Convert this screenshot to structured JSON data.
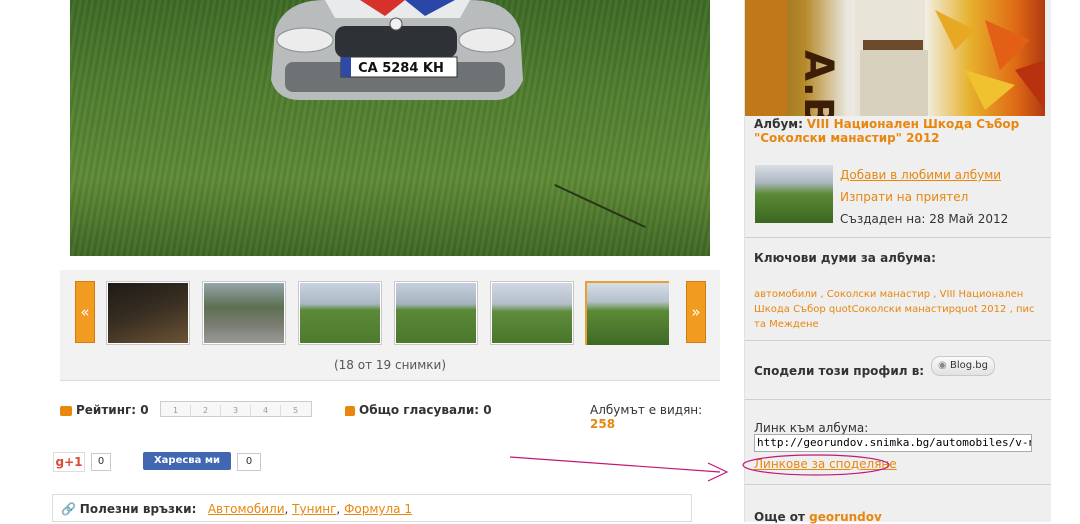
{
  "photo": {
    "plate": "CA 5284 KH"
  },
  "gallery": {
    "prev_arrow": "«",
    "next_arrow": "»",
    "counter": "(18 от 19 снимки)",
    "thumbs": [
      {
        "name": "thumb-1",
        "active": false
      },
      {
        "name": "thumb-2",
        "active": false
      },
      {
        "name": "thumb-3",
        "active": false
      },
      {
        "name": "thumb-4",
        "active": false
      },
      {
        "name": "thumb-5",
        "active": false
      },
      {
        "name": "thumb-6",
        "active": true
      }
    ]
  },
  "rating": {
    "label": "Рейтинг: 0",
    "scale": [
      "1",
      "2",
      "3",
      "4",
      "5"
    ],
    "votes_label": "Общо гласували: 0",
    "views_label": "Албумът е видян:",
    "views_value": "258"
  },
  "social": {
    "gplus_label": "g+1",
    "gplus_count": "0",
    "fb_label": "Харесва ми",
    "fb_count": "0"
  },
  "useful": {
    "label": "Полезни връзки:",
    "links": [
      "Автомобили",
      "Тунинг",
      "Формула 1"
    ],
    "separator": ","
  },
  "sidebar": {
    "album_prefix": "Албум:",
    "album_title": "VIII Национален Шкода Събор \"Соколски манастир\" 2012",
    "add_fav": "Добави в любими албуми",
    "send_friend": "Изпрати на приятел",
    "created": "Създаден на: 28 Май 2012",
    "keywords_title": "Ключови думи за албума:",
    "tags_line1": [
      "автомобили",
      "Соколски манастир",
      "VIII Национален"
    ],
    "tags_line2": "Шкода Събор quotСоколски манастирquot 2012",
    "tags_line2_tail": "пис",
    "tags_line3": "та Междене",
    "share_title": "Сподели този профил в:",
    "blog_button": "Blog.bg",
    "link_label": "Линк към албума:",
    "link_value": "http://georundov.snimka.bg/automobiles/v-nacion",
    "share_links": "Линкове за споделяне",
    "more_prefix": "Още от",
    "more_user": "georundov"
  },
  "colors": {
    "accent": "#e8860e",
    "arrow": "#f29b21",
    "annotation": "#c2187a"
  }
}
